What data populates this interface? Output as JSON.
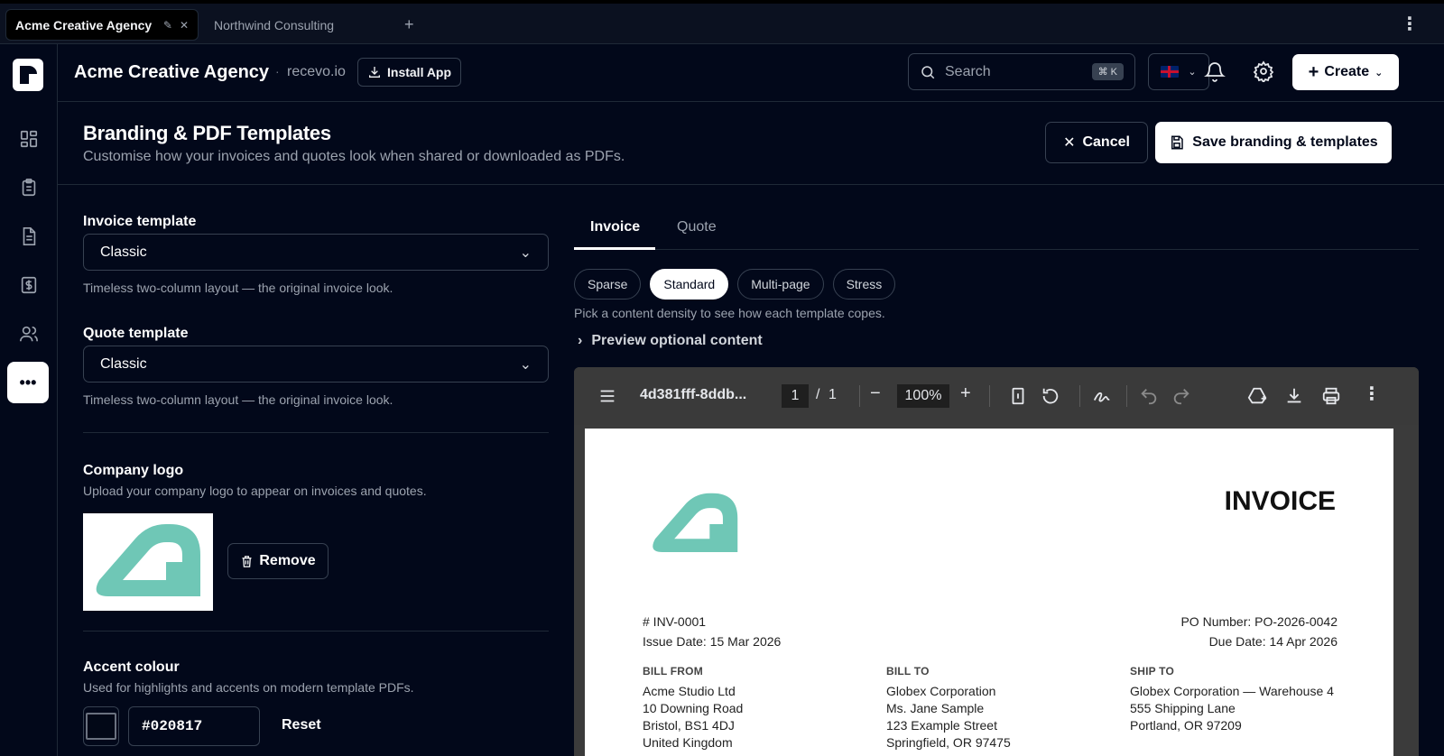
{
  "browser": {
    "tabs": [
      {
        "label": "Acme Creative Agency",
        "active": true
      },
      {
        "label": "Northwind Consulting",
        "active": false
      }
    ],
    "new_tab": "+"
  },
  "header": {
    "org_name": "Acme Creative Agency",
    "separator": "·",
    "domain": "recevo.io",
    "install_label": "Install App",
    "search_placeholder": "Search",
    "search_shortcut": "⌘ K",
    "create_label": "Create"
  },
  "page": {
    "title": "Branding & PDF Templates",
    "subtitle": "Customise how your invoices and quotes look when shared or downloaded as PDFs.",
    "cancel_label": "Cancel",
    "save_label": "Save branding & templates"
  },
  "settings": {
    "invoice_template": {
      "label": "Invoice template",
      "value": "Classic",
      "help": "Timeless two-column layout — the original invoice look."
    },
    "quote_template": {
      "label": "Quote template",
      "value": "Classic",
      "help": "Timeless two-column layout — the original invoice look."
    },
    "logo": {
      "label": "Company logo",
      "help": "Upload your company logo to appear on invoices and quotes.",
      "remove_label": "Remove"
    },
    "accent": {
      "label": "Accent colour",
      "help": "Used for highlights and accents on modern template PDFs.",
      "value": "#020817",
      "reset_label": "Reset"
    }
  },
  "preview": {
    "tabs": [
      "Invoice",
      "Quote"
    ],
    "active_tab": "Invoice",
    "densities": [
      "Sparse",
      "Standard",
      "Multi-page",
      "Stress"
    ],
    "active_density": "Standard",
    "density_help": "Pick a content density to see how each template copes.",
    "optional_label": "Preview optional content",
    "viewer": {
      "filename": "4d381fff-8ddb...",
      "page": "1",
      "page_sep": "/",
      "page_total": "1",
      "zoom": "100%"
    },
    "invoice": {
      "title": "INVOICE",
      "number": "# INV-0001",
      "issue_date": "Issue Date: 15 Mar 2026",
      "po_number": "PO Number: PO-2026-0042",
      "due_date": "Due Date: 14 Apr 2026",
      "bill_from": {
        "heading": "BILL FROM",
        "lines": [
          "Acme Studio Ltd",
          "10 Downing Road",
          "Bristol, BS1 4DJ",
          "United Kingdom"
        ]
      },
      "bill_to": {
        "heading": "BILL TO",
        "lines": [
          "Globex Corporation",
          "Ms. Jane Sample",
          "123 Example Street",
          "Springfield, OR 97475"
        ]
      },
      "ship_to": {
        "heading": "SHIP TO",
        "lines": [
          "Globex Corporation — Warehouse 4",
          "555 Shipping Lane",
          "Portland, OR 97209"
        ]
      }
    }
  },
  "colors": {
    "background": "#02081a",
    "logo_teal": "#6fc7b6",
    "primary_button": "#ffffff"
  },
  "icons": {
    "rail": [
      "dashboard-icon",
      "clipboard-icon",
      "document-icon",
      "dollar-icon",
      "users-icon",
      "more-icon"
    ],
    "header": [
      "search-icon",
      "flag-uk-icon",
      "bell-icon",
      "gear-icon",
      "plus-icon"
    ]
  }
}
